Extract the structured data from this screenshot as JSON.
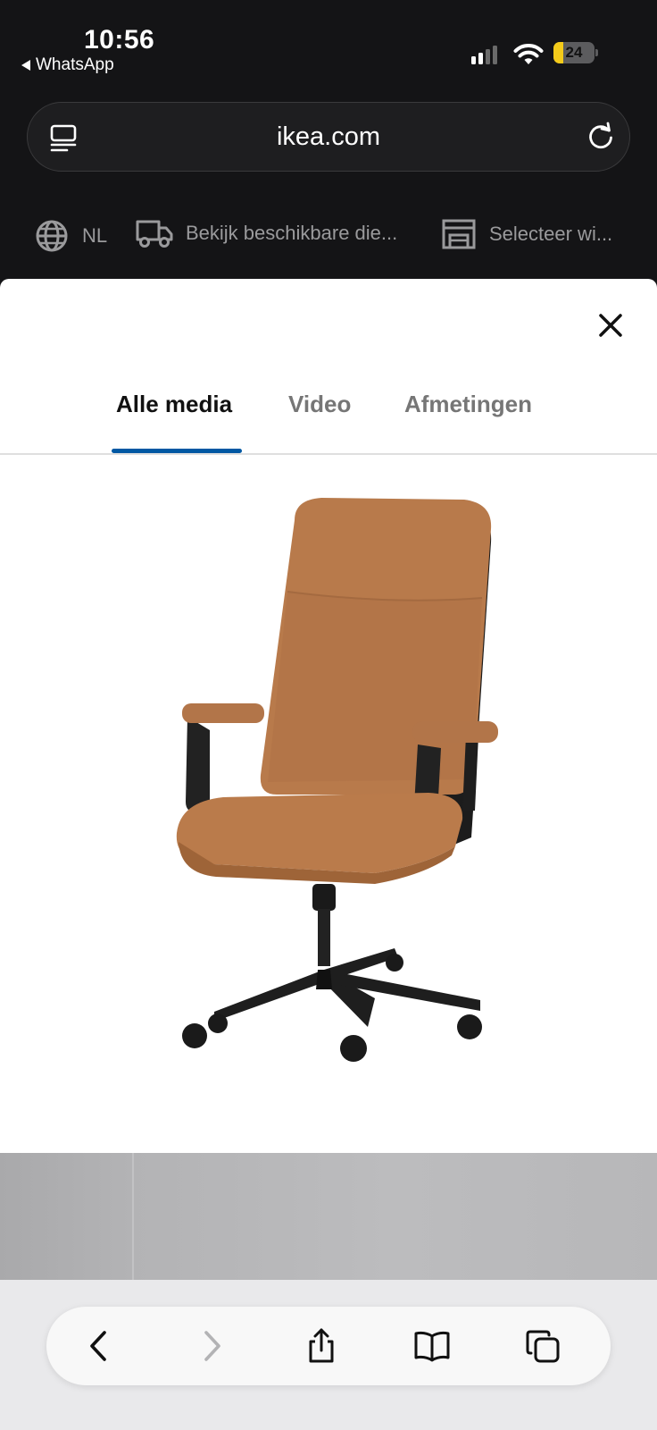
{
  "status_bar": {
    "time": "10:56",
    "back_app": "WhatsApp",
    "battery_level": "24",
    "battery_fraction": 0.24,
    "battery_color": "#f4cb1a",
    "signal_bars_active": 2,
    "signal_bars_total": 4
  },
  "browser": {
    "url": "ikea.com",
    "icons": {
      "reader": "reader-icon",
      "reload": "reload-icon"
    }
  },
  "ikea_strip": {
    "language": "NL",
    "delivery": "Bekijk beschikbare die...",
    "store": "Selecteer wi...",
    "icons": {
      "language": "globe-icon",
      "delivery": "truck-icon",
      "store": "store-icon"
    }
  },
  "media_modal": {
    "tabs": [
      {
        "label": "Alle media",
        "active": true
      },
      {
        "label": "Video",
        "active": false
      },
      {
        "label": "Afmetingen",
        "active": false
      }
    ],
    "accent_color": "#0058a3",
    "image": "office-chair-image"
  },
  "toolbar": {
    "buttons": [
      {
        "name": "back",
        "icon": "chevron-left-icon",
        "enabled": true
      },
      {
        "name": "forward",
        "icon": "chevron-right-icon",
        "enabled": false
      },
      {
        "name": "share",
        "icon": "share-icon",
        "enabled": true
      },
      {
        "name": "bookmarks",
        "icon": "book-icon",
        "enabled": true
      },
      {
        "name": "tabs",
        "icon": "tabs-icon",
        "enabled": true
      }
    ]
  }
}
